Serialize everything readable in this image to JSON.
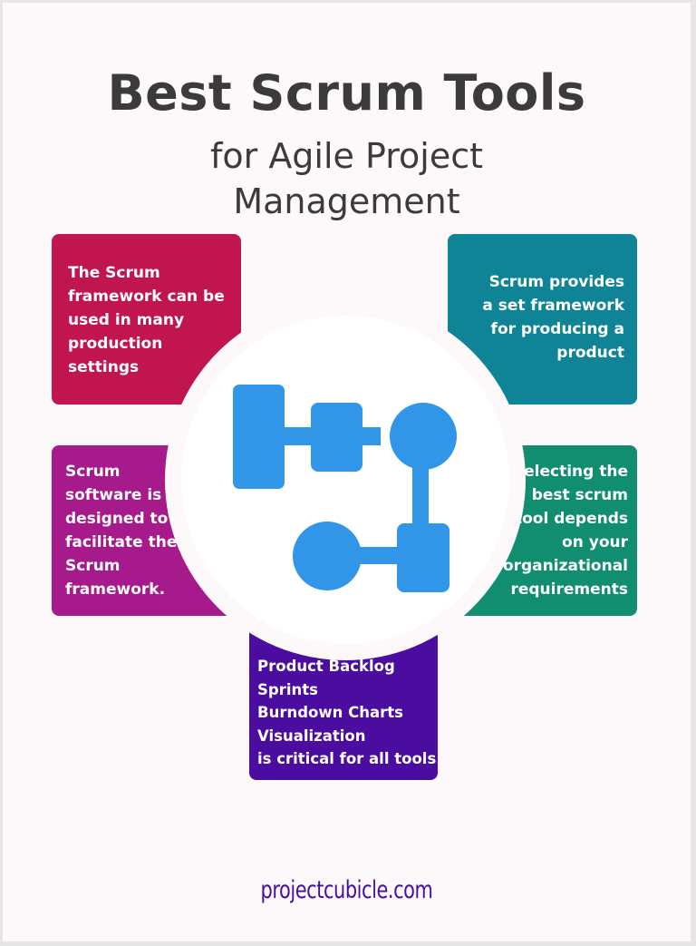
{
  "header": {
    "title": "Best Scrum Tools",
    "subtitle_line1": "for Agile Project",
    "subtitle_line2": "Management"
  },
  "cards": [
    {
      "position": "top-left",
      "color": "#c0154f",
      "lines": [
        "The Scrum",
        "framework can be",
        "used in many",
        "production",
        "settings"
      ]
    },
    {
      "position": "top-right",
      "color": "#0f8497",
      "lines": [
        "Scrum provides",
        "a set framework",
        "for producing a",
        "product"
      ]
    },
    {
      "position": "bottom-left",
      "color": "#a71a8c",
      "lines": [
        "Scrum",
        "software is",
        "designed to",
        "facilitate the",
        "Scrum",
        "framework."
      ]
    },
    {
      "position": "bottom-right",
      "color": "#118d6f",
      "lines": [
        "Selecting the",
        "best scrum",
        "tool depends",
        "on your",
        "organizational",
        "requirements"
      ]
    },
    {
      "position": "bottom-center",
      "color": "#4a0d9f",
      "lines": [
        "Product Backlog",
        "Sprints",
        "Burndown Charts",
        "Visualization",
        "is critical for all tools"
      ]
    }
  ],
  "center_icon": {
    "name": "workflow-diagram-icon",
    "color": "#3296e8"
  },
  "footer": {
    "site": "projectcubicle.com"
  }
}
